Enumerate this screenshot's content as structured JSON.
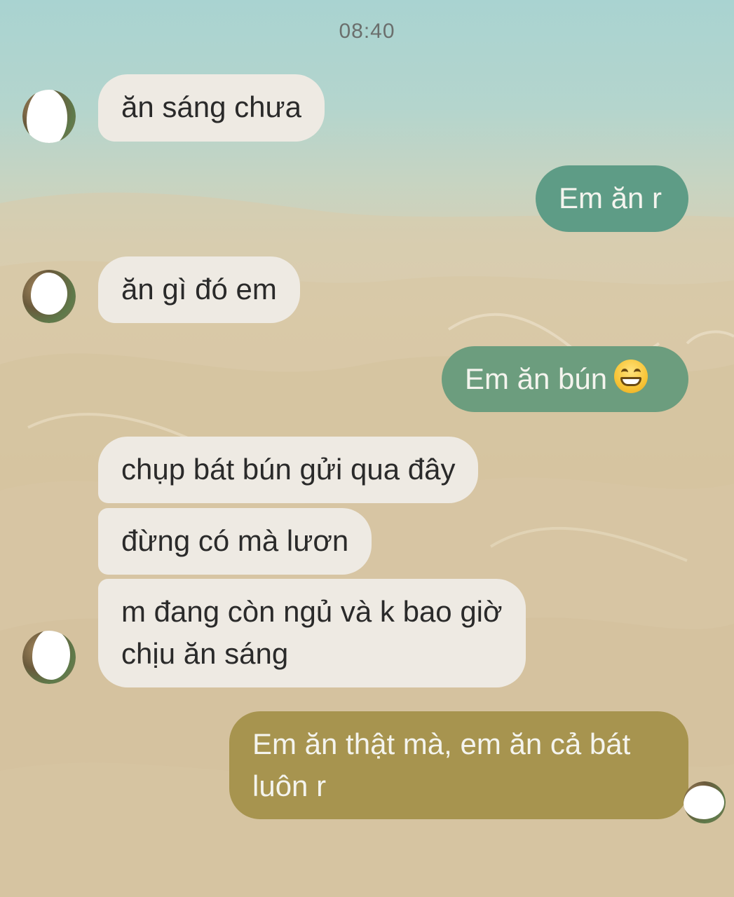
{
  "chat": {
    "timestamp": "08:40",
    "messages": [
      {
        "sender": "them",
        "text": "ăn sáng chưa"
      },
      {
        "sender": "me",
        "text": "Em ăn r"
      },
      {
        "sender": "them",
        "text": "ăn gì đó em"
      },
      {
        "sender": "me",
        "text": "Em ăn bún",
        "emoji": "grinning-face-icon"
      },
      {
        "sender": "them",
        "text": "chụp bát bún gửi qua đây"
      },
      {
        "sender": "them",
        "text": "đừng có mà lươn"
      },
      {
        "sender": "them",
        "lines": [
          "m đang còn ngủ và k bao giờ",
          "chịu ăn sáng"
        ]
      },
      {
        "sender": "me",
        "lines": [
          "Em ăn thật mà, em ăn cả bát",
          "luôn r"
        ]
      }
    ]
  },
  "colors": {
    "incoming_bubble": "#eeeae3",
    "outgoing_bubble_teal": "#5e9c86",
    "outgoing_bubble_olive": "#a7944f"
  }
}
